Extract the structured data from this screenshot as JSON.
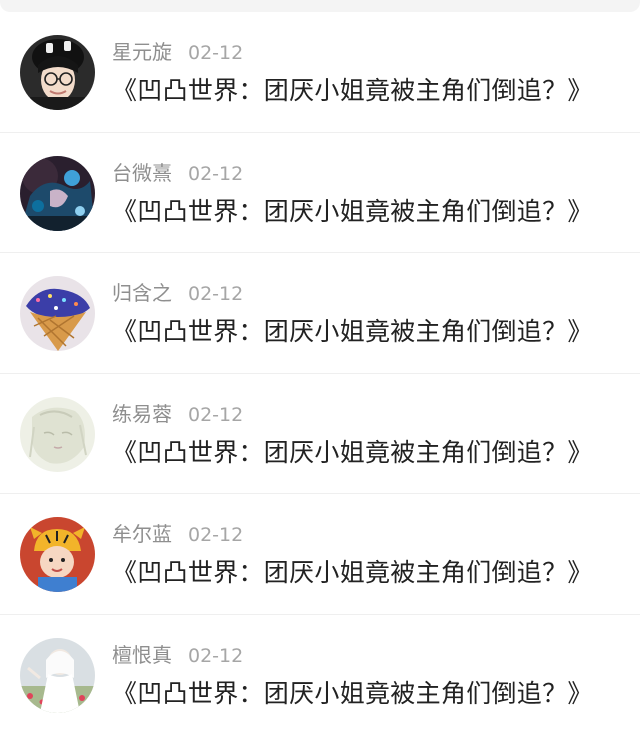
{
  "items": [
    {
      "username": "星元旋",
      "date": "02-12",
      "title": "《凹凸世界：团厌小姐竟被主角们倒追？》",
      "avatar_icon": "avatar-boy-glasses"
    },
    {
      "username": "台微熹",
      "date": "02-12",
      "title": "《凹凸世界：团厌小姐竟被主角们倒追？》",
      "avatar_icon": "avatar-dark-anime"
    },
    {
      "username": "归含之",
      "date": "02-12",
      "title": "《凹凸世界：团厌小姐竟被主角们倒追？》",
      "avatar_icon": "avatar-ice-cream-cone"
    },
    {
      "username": "练易蓉",
      "date": "02-12",
      "title": "《凹凸世界：团厌小姐竟被主角们倒追？》",
      "avatar_icon": "avatar-pale-sketch"
    },
    {
      "username": "牟尔蓝",
      "date": "02-12",
      "title": "《凹凸世界：团厌小姐竟被主角们倒追？》",
      "avatar_icon": "avatar-tiger-hat-child"
    },
    {
      "username": "檀恨真",
      "date": "02-12",
      "title": "《凹凸世界：团厌小姐竟被主角们倒追？》",
      "avatar_icon": "avatar-white-dress-girl"
    }
  ]
}
